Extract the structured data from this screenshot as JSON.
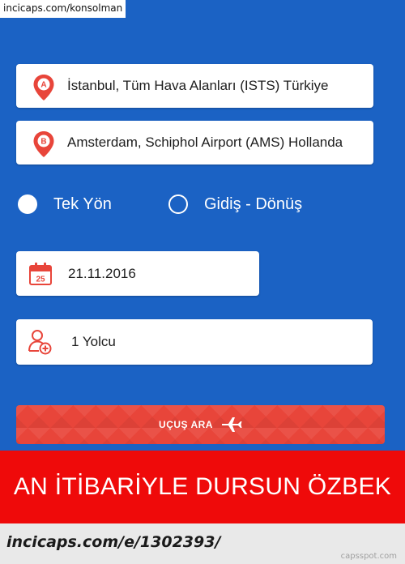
{
  "watermark_top": "incicaps.com/konsolman",
  "form": {
    "origin": {
      "pin_letter": "A",
      "value": "İstanbul, Tüm Hava Alanları (ISTS) Türkiye"
    },
    "destination": {
      "pin_letter": "B",
      "value": "Amsterdam, Schiphol Airport (AMS) Hollanda"
    },
    "trip_type": {
      "one_way_label": "Tek Yön",
      "round_trip_label": "Gidiş - Dönüş",
      "selected": "one_way"
    },
    "date": {
      "calendar_day": "25",
      "value": "21.11.2016"
    },
    "passengers": {
      "value": "1 Yolcu"
    },
    "search_button_label": "UÇUŞ ARA"
  },
  "caption": {
    "headline": "AN İTİBARİYLE DURSUN ÖZBEK"
  },
  "footer": {
    "url": "incicaps.com/e/1302393/",
    "brand": "capsspot.com"
  },
  "colors": {
    "background_blue": "#1b62c4",
    "accent_red": "#e8453a",
    "banner_red": "#ef0a0a"
  }
}
